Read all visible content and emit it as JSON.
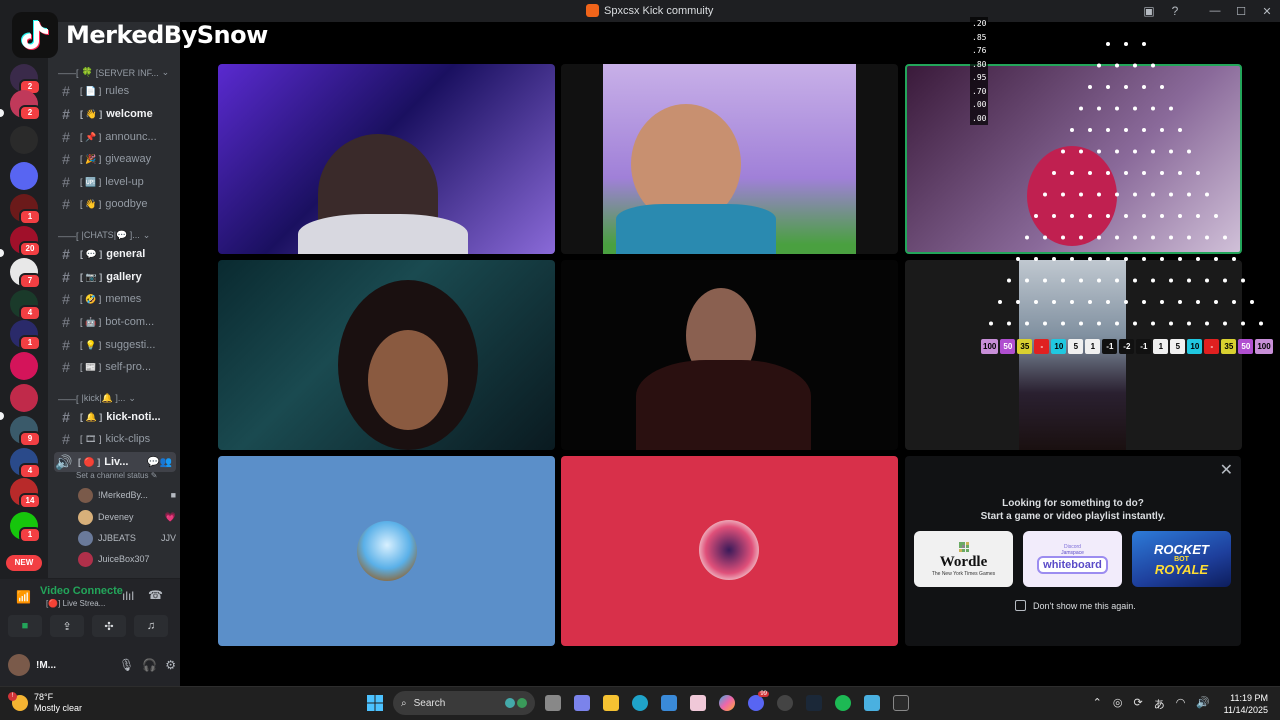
{
  "window": {
    "title": "Spxcsx Kick commuity"
  },
  "watermark": {
    "channel": "MerkedBySnow"
  },
  "rail": {
    "servers": [
      {
        "color": "#3a2a4a",
        "badge": "2"
      },
      {
        "color": "#c0395a",
        "badge": "2"
      },
      {
        "color": "#2a2a2a",
        "badge": ""
      },
      {
        "color": "#5865f2",
        "badge": ""
      },
      {
        "color": "#6b1a1a",
        "badge": "1"
      },
      {
        "color": "#a0102a",
        "badge": "20"
      },
      {
        "color": "#e8e8e8",
        "badge": "7"
      },
      {
        "color": "#1a3a2a",
        "badge": "4"
      },
      {
        "color": "#2a2a6a",
        "badge": "1"
      },
      {
        "color": "#d4145a",
        "badge": ""
      },
      {
        "color": "#c02a4a",
        "badge": ""
      },
      {
        "color": "#3a5a6a",
        "badge": "9"
      },
      {
        "color": "#2a4a8a",
        "badge": "4"
      },
      {
        "color": "#b82a2a",
        "badge": "14"
      },
      {
        "color": "#16c60c",
        "badge": "1"
      }
    ],
    "new_label": "NEW"
  },
  "channels": {
    "categories": [
      {
        "label": "[SERVER INF...",
        "emoji": "🍀"
      },
      {
        "label": "|CHATS|💬 ]...",
        "emoji": "💬"
      },
      {
        "label": "|kick|🔔 ]...",
        "emoji": "🔔"
      }
    ],
    "items": [
      {
        "label": "rules",
        "emoji": "📄",
        "bold": false
      },
      {
        "label": "welcome",
        "emoji": "👋",
        "bold": true
      },
      {
        "label": "announc...",
        "emoji": "📌",
        "bold": false
      },
      {
        "label": "giveaway",
        "emoji": "🎉",
        "bold": false
      },
      {
        "label": "level-up",
        "emoji": "🆙",
        "bold": false
      },
      {
        "label": "goodbye",
        "emoji": "👋",
        "bold": false
      },
      {
        "label": "general",
        "emoji": "💬",
        "bold": true
      },
      {
        "label": "gallery",
        "emoji": "📷",
        "bold": true
      },
      {
        "label": "memes",
        "emoji": "🤣",
        "bold": false
      },
      {
        "label": "bot-com...",
        "emoji": "🤖",
        "bold": false
      },
      {
        "label": "suggesti...",
        "emoji": "💡",
        "bold": false
      },
      {
        "label": "self-pro...",
        "emoji": "📰",
        "bold": false
      },
      {
        "label": "kick-noti...",
        "emoji": "🔔",
        "bold": true
      },
      {
        "label": "kick-clips",
        "emoji": "🎞",
        "bold": false
      }
    ],
    "voice_channel": {
      "label": "Liv...",
      "emoji": "🔴"
    },
    "status_hint": "Set a channel status",
    "voice_users": [
      {
        "name": "!MerkedBy...",
        "color": "#7a5a4a",
        "extra": "cam"
      },
      {
        "name": "Deveney",
        "color": "#d8b07a",
        "extra": "💗"
      },
      {
        "name": "JJBEATS",
        "color": "#6a7a9a",
        "extra": "JJV"
      },
      {
        "name": "JuiceBox307",
        "color": "#b0304a",
        "extra": ""
      }
    ]
  },
  "voice_panel": {
    "title": "Video Connecte",
    "subtitle": "Live Strea..."
  },
  "user_panel": {
    "name": "!M..."
  },
  "overlay": {
    "numbers": [
      ".20",
      ".85",
      ".76",
      ".80",
      ".95",
      ".70",
      ".00",
      ".00"
    ],
    "chips": [
      {
        "v": "100",
        "c": "#c88fd8"
      },
      {
        "v": "50",
        "c": "#b04fd0"
      },
      {
        "v": "35",
        "c": "#d8d030"
      },
      {
        "v": "-",
        "c": "#e02020"
      },
      {
        "v": "10",
        "c": "#20c8e0"
      },
      {
        "v": "5",
        "c": "#f0f0f0"
      },
      {
        "v": "1",
        "c": "#f0f0f0"
      },
      {
        "v": "-1",
        "c": "#111111"
      },
      {
        "v": "-2",
        "c": "#111111"
      },
      {
        "v": "-1",
        "c": "#111111"
      },
      {
        "v": "1",
        "c": "#f0f0f0"
      },
      {
        "v": "5",
        "c": "#f0f0f0"
      },
      {
        "v": "10",
        "c": "#20c8e0"
      },
      {
        "v": "-",
        "c": "#e02020"
      },
      {
        "v": "35",
        "c": "#d8d030"
      },
      {
        "v": "50",
        "c": "#b04fd0"
      },
      {
        "v": "100",
        "c": "#c88fd8"
      }
    ]
  },
  "activity": {
    "line1": "Looking for something to do?",
    "line2": "Start a game or video playlist instantly.",
    "cards": {
      "wordle": {
        "title": "Wordle",
        "sub": "The New York Times Games"
      },
      "whiteboard": {
        "brand": "Discord",
        "pre": "Jamspace",
        "title": "whiteboard"
      },
      "rocket": {
        "l1": "ROCKET",
        "l2": "BOT",
        "l3": "ROYALE"
      }
    },
    "dont_show": "Don't show me this again."
  },
  "taskbar": {
    "temp": "78°F",
    "weather": "Mostly clear",
    "search": "Search",
    "time": "11:19 PM",
    "date": "11/14/2025"
  },
  "colors": {
    "online": "#23a55a",
    "danger": "#f23f43",
    "tile_blue": "#5b8fc9",
    "tile_red": "#d8304a"
  }
}
